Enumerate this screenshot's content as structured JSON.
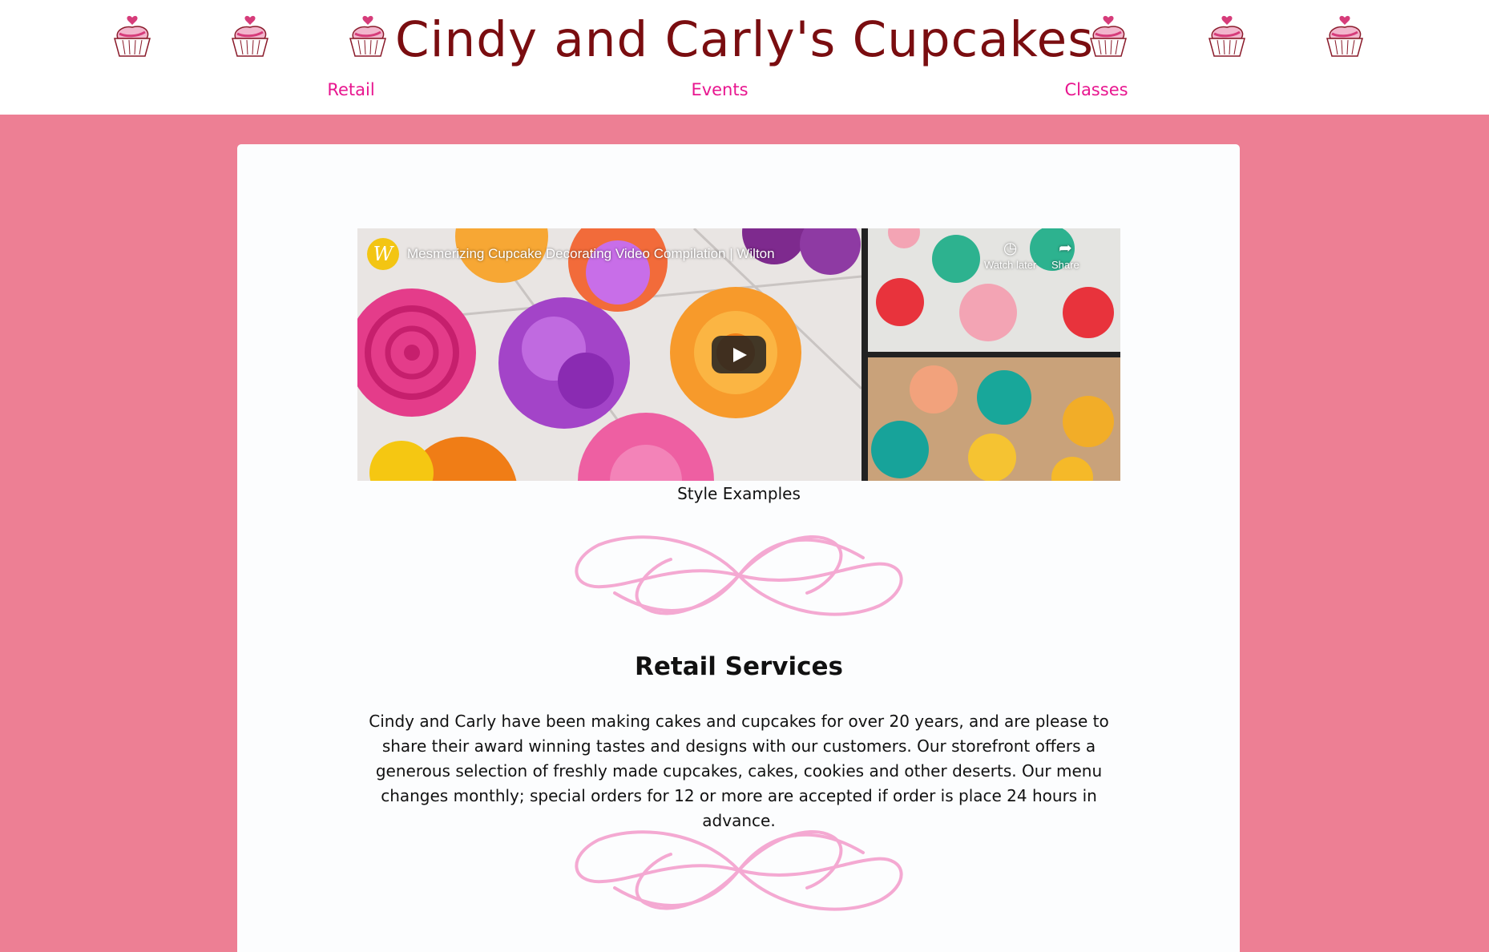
{
  "header": {
    "title": "Cindy and Carly's Cupcakes",
    "nav": [
      {
        "label": "Retail"
      },
      {
        "label": "Events"
      },
      {
        "label": "Classes"
      }
    ],
    "decoration_icon": "cupcake-icon"
  },
  "video": {
    "title": "Mesmerizing Cupcake Decorating Video Compilation | Wilton",
    "channel_logo_letter": "W",
    "watch_later_label": "Watch later",
    "share_label": "Share",
    "play_icon": "play-icon"
  },
  "caption": "Style Examples",
  "retail": {
    "heading": "Retail Services",
    "text": "Cindy and Carly have been making cakes and cupcakes for over 20 years, and are please to share their award winning tastes and designs with our customers. Our storefront offers a generous selection of freshly made cupcakes, cakes, cookies and other deserts. Our menu changes monthly; special orders for 12 or more are accepted if order is place 24 hours in advance."
  },
  "colors": {
    "background": "#ed7f94",
    "title": "#7a0d10",
    "nav": "#e8168f",
    "flourish": "#f4a9d2"
  }
}
